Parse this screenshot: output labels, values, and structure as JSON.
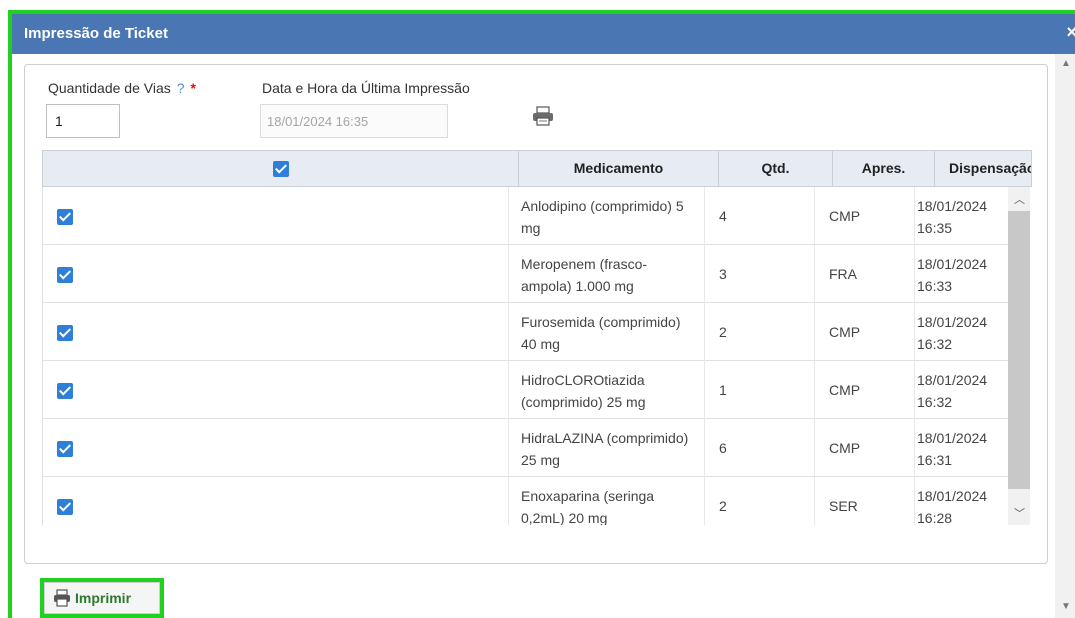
{
  "window": {
    "title": "Impressão de Ticket",
    "close_icon": "×"
  },
  "form": {
    "qtd_label": "Quantidade de Vias",
    "help_icon": "?",
    "required_mark": "*",
    "qtd_value": "1",
    "data_label": "Data e Hora da Última Impressão",
    "data_value": "18/01/2024 16:35"
  },
  "table": {
    "columns": [
      "",
      "Medicamento",
      "Qtd.",
      "Apres.",
      "Dispensação"
    ],
    "rows": [
      {
        "medicamento": "Anlodipino (comprimido) 5 mg",
        "qtd": "4",
        "apres": "CMP",
        "data": "18/01/2024",
        "hora": "16:35"
      },
      {
        "medicamento": "Meropenem (frasco-ampola) 1.000 mg",
        "qtd": "3",
        "apres": "FRA",
        "data": "18/01/2024",
        "hora": "16:33"
      },
      {
        "medicamento": "Furosemida (comprimido) 40 mg",
        "qtd": "2",
        "apres": "CMP",
        "data": "18/01/2024",
        "hora": "16:32"
      },
      {
        "medicamento": "HidroCLOROtiazida (comprimido) 25 mg",
        "qtd": "1",
        "apres": "CMP",
        "data": "18/01/2024",
        "hora": "16:32"
      },
      {
        "medicamento": "HidraLAZINA (comprimido) 25 mg",
        "qtd": "6",
        "apres": "CMP",
        "data": "18/01/2024",
        "hora": "16:31"
      },
      {
        "medicamento": "Enoxaparina (seringa 0,2mL) 20 mg",
        "qtd": "2",
        "apres": "SER",
        "data": "18/01/2024",
        "hora": "16:28"
      }
    ]
  },
  "footer": {
    "print_button": "Imprimir"
  },
  "colors": {
    "titlebar": "#4a77b4",
    "highlight": "#22d022",
    "checkbox": "#2f7ed8"
  }
}
